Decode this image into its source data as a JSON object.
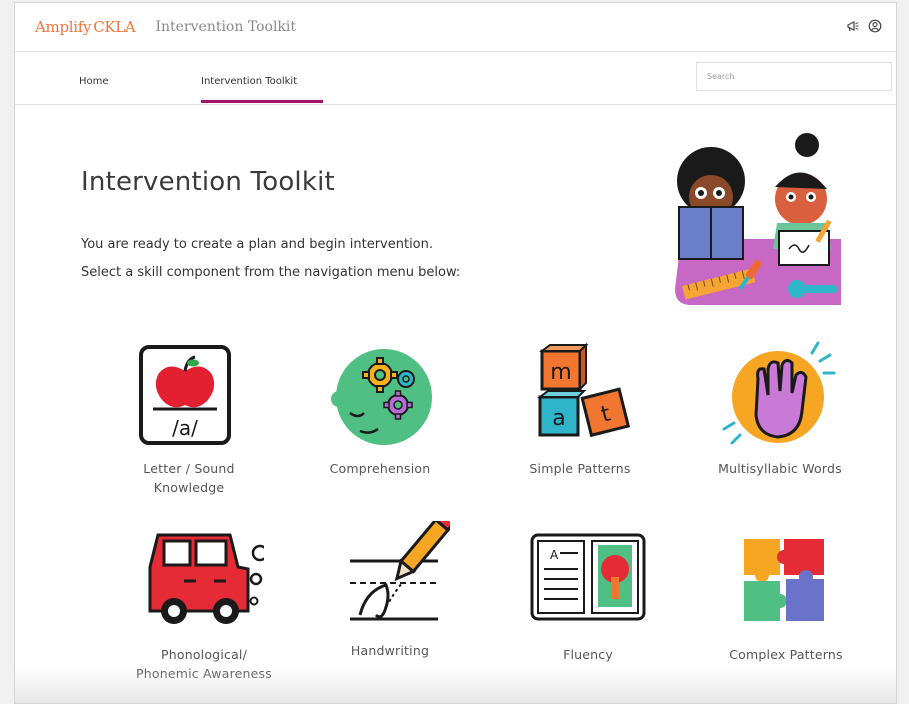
{
  "header": {
    "brand_amplify": "Amplify",
    "brand_ckla": "CKLA",
    "app_title": "Intervention Toolkit",
    "icons": [
      "megaphone-icon",
      "user-account-icon"
    ]
  },
  "nav": {
    "tabs": [
      {
        "label": "Home",
        "active": false
      },
      {
        "label": "Intervention Toolkit",
        "active": true
      }
    ],
    "search_placeholder": "Search"
  },
  "hero": {
    "title": "Intervention Toolkit",
    "line1": "You are ready to create a plan and begin intervention.",
    "line2": "Select a skill component from the navigation menu below:"
  },
  "skills": [
    {
      "label": "Letter / Sound Knowledge",
      "line1": "Letter / Sound",
      "line2": "Knowledge",
      "icon": "apple-letter-card-icon"
    },
    {
      "label": "Comprehension",
      "icon": "head-gears-icon"
    },
    {
      "label": "Simple Patterns",
      "icon": "letter-blocks-icon",
      "blocks": [
        "m",
        "a",
        "t"
      ]
    },
    {
      "label": "Multisyllabic Words",
      "icon": "clapping-hand-icon"
    },
    {
      "label": "Phonological/ Phonemic Awareness",
      "line1": "Phonological/",
      "line2": "Phonemic Awareness",
      "icon": "car-icon"
    },
    {
      "label": "Handwriting",
      "icon": "pencil-writing-icon"
    },
    {
      "label": "Fluency",
      "icon": "open-book-icon",
      "book_letter": "A"
    },
    {
      "label": "Complex Patterns",
      "icon": "puzzle-pieces-icon"
    }
  ],
  "colors": {
    "brand_orange": "#f0763b",
    "active_tab_underline": "#a4126c"
  }
}
